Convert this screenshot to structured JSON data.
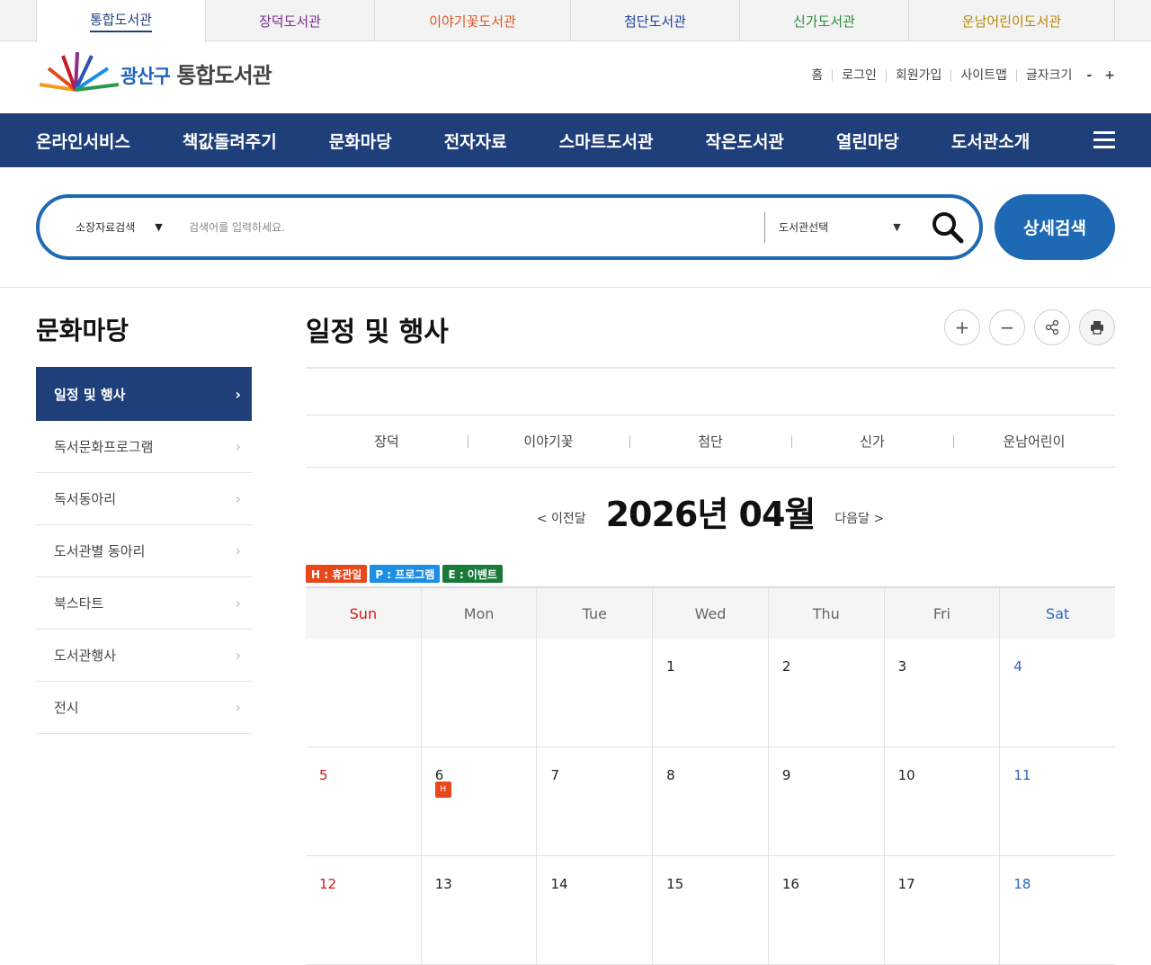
{
  "colors": {
    "navy": "#1f3f7a",
    "blue": "#1e69b3",
    "sun": "#d0161b",
    "sat": "#2b63c4",
    "holiday": "#e8471a",
    "program": "#1a8fe3",
    "event": "#1a7a3a"
  },
  "topTabs": [
    {
      "label": "통합도서관",
      "color": "#1f3f7a"
    },
    {
      "label": "장덕도서관",
      "color": "#7a2a8e"
    },
    {
      "label": "이야기꽃도서관",
      "color": "#e0541f"
    },
    {
      "label": "첨단도서관",
      "color": "#1f3f9e"
    },
    {
      "label": "신가도서관",
      "color": "#2a8a3a"
    },
    {
      "label": "운남어린이도서관",
      "color": "#b8860b"
    }
  ],
  "logo": {
    "part1": "광산구",
    "part2": "통합도서관"
  },
  "util": {
    "home": "홈",
    "login": "로그인",
    "join": "회원가입",
    "sitemap": "사이트맵",
    "fontsize": "글자크기",
    "minus": "-",
    "plus": "+"
  },
  "gnb": [
    "온라인서비스",
    "책값돌려주기",
    "문화마당",
    "전자자료",
    "스마트도서관",
    "작은도서관",
    "열린마당",
    "도서관소개"
  ],
  "search": {
    "category": "소장자료검색",
    "placeholder": "검색어를 입력하세요.",
    "library": "도서관선택",
    "advanced": "상세검색"
  },
  "lnb": {
    "title": "문화마당",
    "items": [
      "일정 및 행사",
      "독서문화프로그램",
      "독서동아리",
      "도서관별 동아리",
      "북스타트",
      "도서관행사",
      "전시"
    ]
  },
  "content": {
    "title": "일정 및 행사",
    "libTabs": [
      "장덕",
      "이야기꽃",
      "첨단",
      "신가",
      "운남어린이"
    ],
    "prev": "< 이전달",
    "month": "2026년 04월",
    "next": "다음달 >",
    "legend": {
      "h": "H : 휴관일",
      "p": "P : 프로그램",
      "e": "E : 이벤트"
    },
    "weekdays": [
      "Sun",
      "Mon",
      "Tue",
      "Wed",
      "Thu",
      "Fri",
      "Sat"
    ],
    "weeks": [
      [
        "",
        "",
        "",
        "1",
        "2",
        "3",
        "4"
      ],
      [
        "5",
        "6",
        "7",
        "8",
        "9",
        "10",
        "11"
      ],
      [
        "12",
        "13",
        "14",
        "15",
        "16",
        "17",
        "18"
      ]
    ],
    "holidayBadge": "H"
  }
}
